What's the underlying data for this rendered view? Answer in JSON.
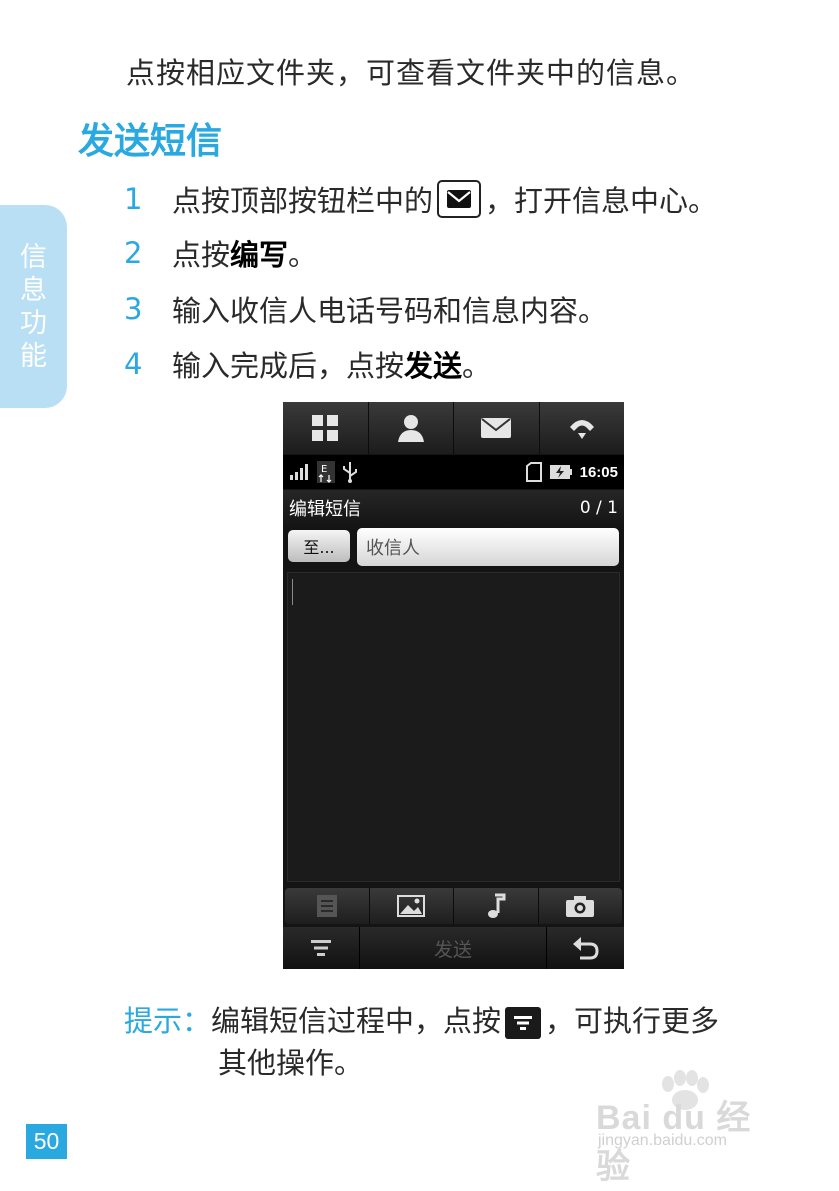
{
  "intro_text": "点按相应文件夹，可查看文件夹中的信息。",
  "section_title": "发送短信",
  "side_tab": [
    "信",
    "息",
    "功",
    "能"
  ],
  "steps": [
    {
      "num": "1",
      "before": "点按顶部按钮栏中的",
      "after": "，打开信息中心。"
    },
    {
      "num": "2",
      "before": "点按",
      "bold": "编写",
      "after": "。"
    },
    {
      "num": "3",
      "before": "输入收信人电话号码和信息内容。"
    },
    {
      "num": "4",
      "before": "输入完成后，点按",
      "bold": "发送",
      "after": "。"
    }
  ],
  "phone": {
    "top_buttons": [
      "apps-grid-icon",
      "contacts-person-icon",
      "messaging-envelope-icon",
      "call-icon"
    ],
    "status_time": "16:05",
    "title": "编辑短信",
    "count": "0 / 1",
    "to_button": "至...",
    "recipient_placeholder": "收信人",
    "attach_buttons": [
      "text-template-icon",
      "image-icon",
      "music-note-icon",
      "camera-icon"
    ],
    "send_label": "发送"
  },
  "tip": {
    "label": "提示：",
    "before": "编辑短信过程中，点按",
    "after": "，可执行更多",
    "line2": "其他操作。"
  },
  "page_number": "50",
  "watermark": {
    "brand": "Bai du 经验",
    "url": "jingyan.baidu.com"
  },
  "colors": {
    "accent": "#29a9e0",
    "side_tab": "#b9dff4"
  }
}
